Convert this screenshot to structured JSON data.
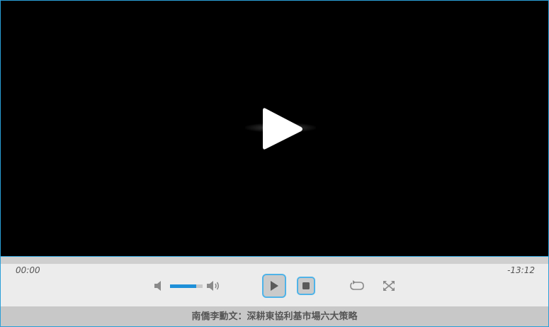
{
  "player": {
    "current_time": "00:00",
    "remaining_time": "-13:12",
    "progress": 0,
    "volume": 0.8,
    "title": "南僑李勳文：深耕東協利基市場六大策略"
  },
  "colors": {
    "accent": "#1e90d8",
    "border": "#2a9fd8",
    "controls_bg": "#ececec",
    "title_bg": "#c8c8c8"
  },
  "icons": {
    "big_play": "play-icon",
    "mute": "speaker-low-icon",
    "volume_max": "speaker-high-icon",
    "play": "play-icon",
    "stop": "stop-icon",
    "loop": "loop-icon",
    "fullscreen": "fullscreen-icon"
  }
}
